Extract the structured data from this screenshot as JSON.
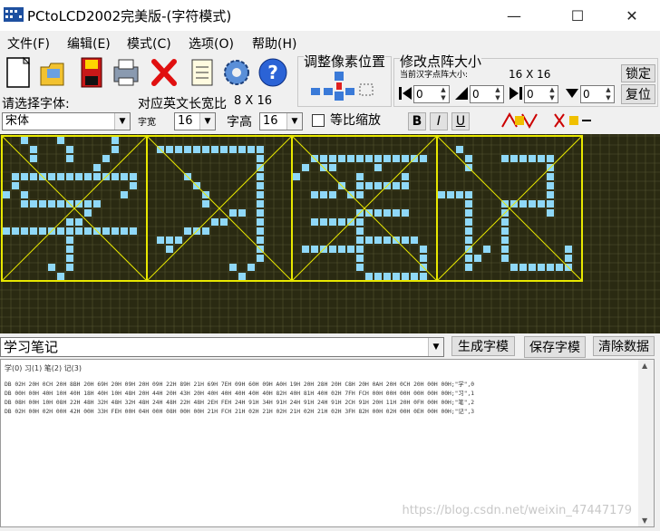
{
  "window": {
    "title": "PCtoLCD2002完美版-(字符模式)",
    "minimize": "—",
    "maximize": "☐",
    "close": "✕"
  },
  "menu": [
    "文件(F)",
    "编辑(E)",
    "模式(C)",
    "选项(O)",
    "帮助(H)"
  ],
  "toolbar": {
    "icons": [
      "new-file-icon",
      "open-folder-icon",
      "save-icon",
      "print-icon",
      "delete-icon",
      "notepad-icon",
      "gear-icon",
      "help-icon"
    ]
  },
  "font_panel": {
    "select_font_label": "请选择字体:",
    "english_width_label": "对应英文长宽比",
    "english_width_value": "8 X 16",
    "font_value": "宋体",
    "width_label": "字宽",
    "width_value": "16",
    "height_label": "字高",
    "height_value": "16",
    "keep_ratio_label": "等比缩放",
    "bold": "B",
    "italic": "I",
    "underline": "U"
  },
  "adjust_panel": {
    "title": "调整像素位置"
  },
  "dot_panel": {
    "title": "修改点阵大小",
    "current_label": "当前汉字点阵大小:",
    "current_value": "16 X 16",
    "lock_button": "锁定",
    "restore_button": "复位",
    "spin_values": [
      "0",
      "0",
      "0",
      "0"
    ]
  },
  "matrix": {
    "colors": {
      "background": "#2a2a12",
      "grid": "#555530",
      "pixel_on": "#8fd8f8",
      "frame": "#e8e800"
    },
    "chars": [
      "学",
      "习",
      "笔",
      "记"
    ]
  },
  "input": {
    "text": "学习笔记",
    "generate_button": "生成字模",
    "save_button": "保存字模",
    "clear_button": "清除数据"
  },
  "output": {
    "header": "学(0) 习(1) 笔(2) 记(3)",
    "lines": [
      "DB 02H 20H 0CH 20H 8BH 20H 69H 20H 09H 20H 09H 22H 89H 21H 69H 7EH 09H 60H 09H A0H 19H 20H 28H 20H C8H 20H 0AH 20H 0CH 20H 00H 00H;\"学\",0",
      "DB 00H 00H 40H 10H 40H 18H 40H 10H 48H 20H 44H 20H 43H 20H 40H 40H 40H 40H 40H 82H 40H 81H 40H 02H 7FH FCH 00H 00H 00H 00H 00H 00H;\"习\",1",
      "DB 08H 00H 10H 08H 22H 48H 32H 48H 32H 48H 24H 48H 22H 48H 2EH FEH 24H 91H 34H 91H 24H 91H 24H 91H 2CH 91H 20H 11H 20H 0FH 00H 00H;\"笔\",2",
      "DB 02H 00H 02H 00H 42H 00H 33H FEH 00H 04H 00H 08H 00H 00H 21H FCH 21H 02H 21H 02H 21H 02H 21H 02H 3FH 82H 00H 02H 00H 0EH 00H 00H;\"记\",3"
    ]
  },
  "watermark": "https://blog.csdn.net/weixin_47447179"
}
